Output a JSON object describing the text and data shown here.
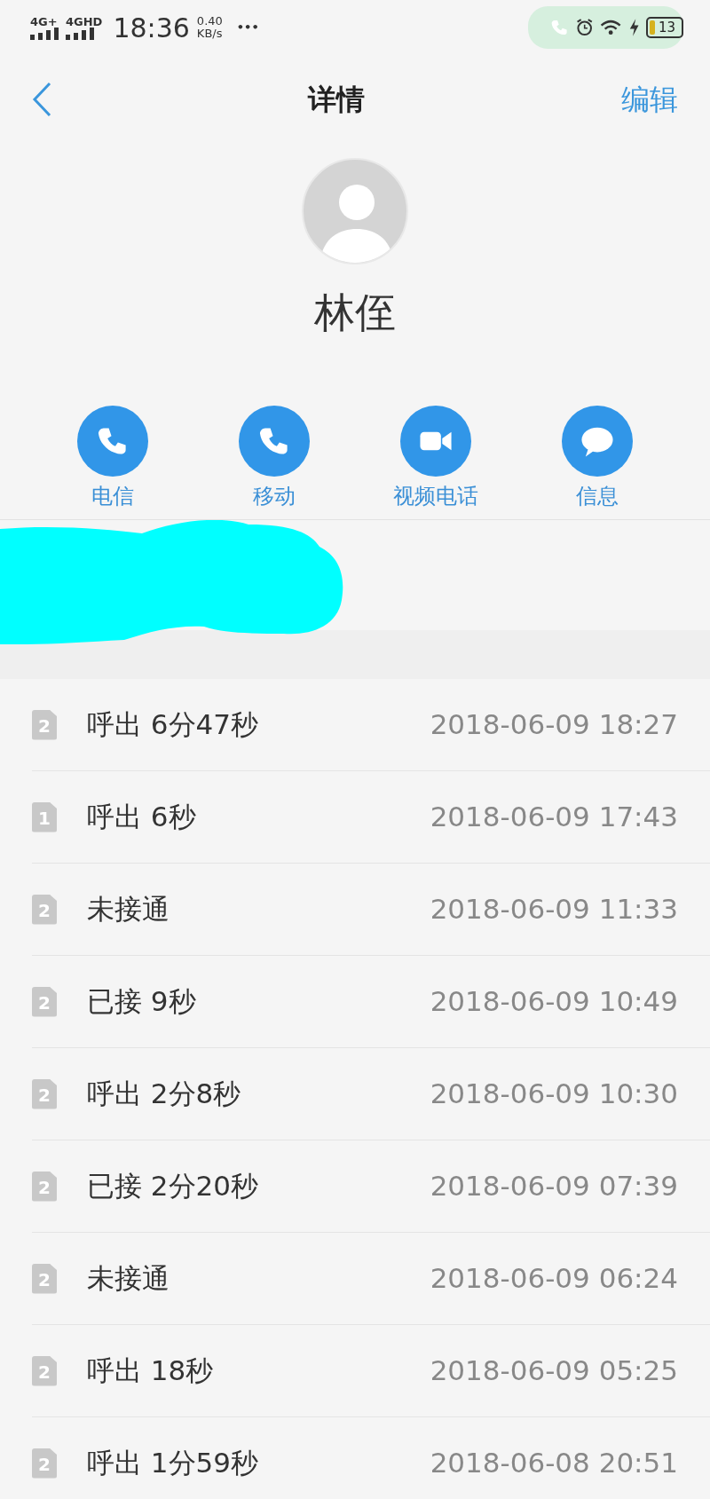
{
  "status_bar": {
    "networks": [
      "4G+",
      "4GHD"
    ],
    "time": "18:36",
    "speed_value": "0.40",
    "speed_unit": "KB/s",
    "more": "•••",
    "battery": "13"
  },
  "header": {
    "title": "详情",
    "action": "编辑"
  },
  "contact": {
    "name": "林侄"
  },
  "actions": [
    {
      "kind": "phone",
      "label": "电信"
    },
    {
      "kind": "phone",
      "label": "移动"
    },
    {
      "kind": "video",
      "label": "视频电话"
    },
    {
      "kind": "message",
      "label": "信息"
    }
  ],
  "calls": [
    {
      "sim": "2",
      "text": "呼出 6分47秒",
      "time": "2018-06-09 18:27"
    },
    {
      "sim": "1",
      "text": "呼出 6秒",
      "time": "2018-06-09 17:43"
    },
    {
      "sim": "2",
      "text": "未接通",
      "time": "2018-06-09 11:33"
    },
    {
      "sim": "2",
      "text": "已接 9秒",
      "time": "2018-06-09 10:49"
    },
    {
      "sim": "2",
      "text": "呼出 2分8秒",
      "time": "2018-06-09 10:30"
    },
    {
      "sim": "2",
      "text": "已接 2分20秒",
      "time": "2018-06-09 07:39"
    },
    {
      "sim": "2",
      "text": "未接通",
      "time": "2018-06-09 06:24"
    },
    {
      "sim": "2",
      "text": "呼出 18秒",
      "time": "2018-06-09 05:25"
    },
    {
      "sim": "2",
      "text": "呼出 1分59秒",
      "time": "2018-06-08 20:51"
    }
  ]
}
